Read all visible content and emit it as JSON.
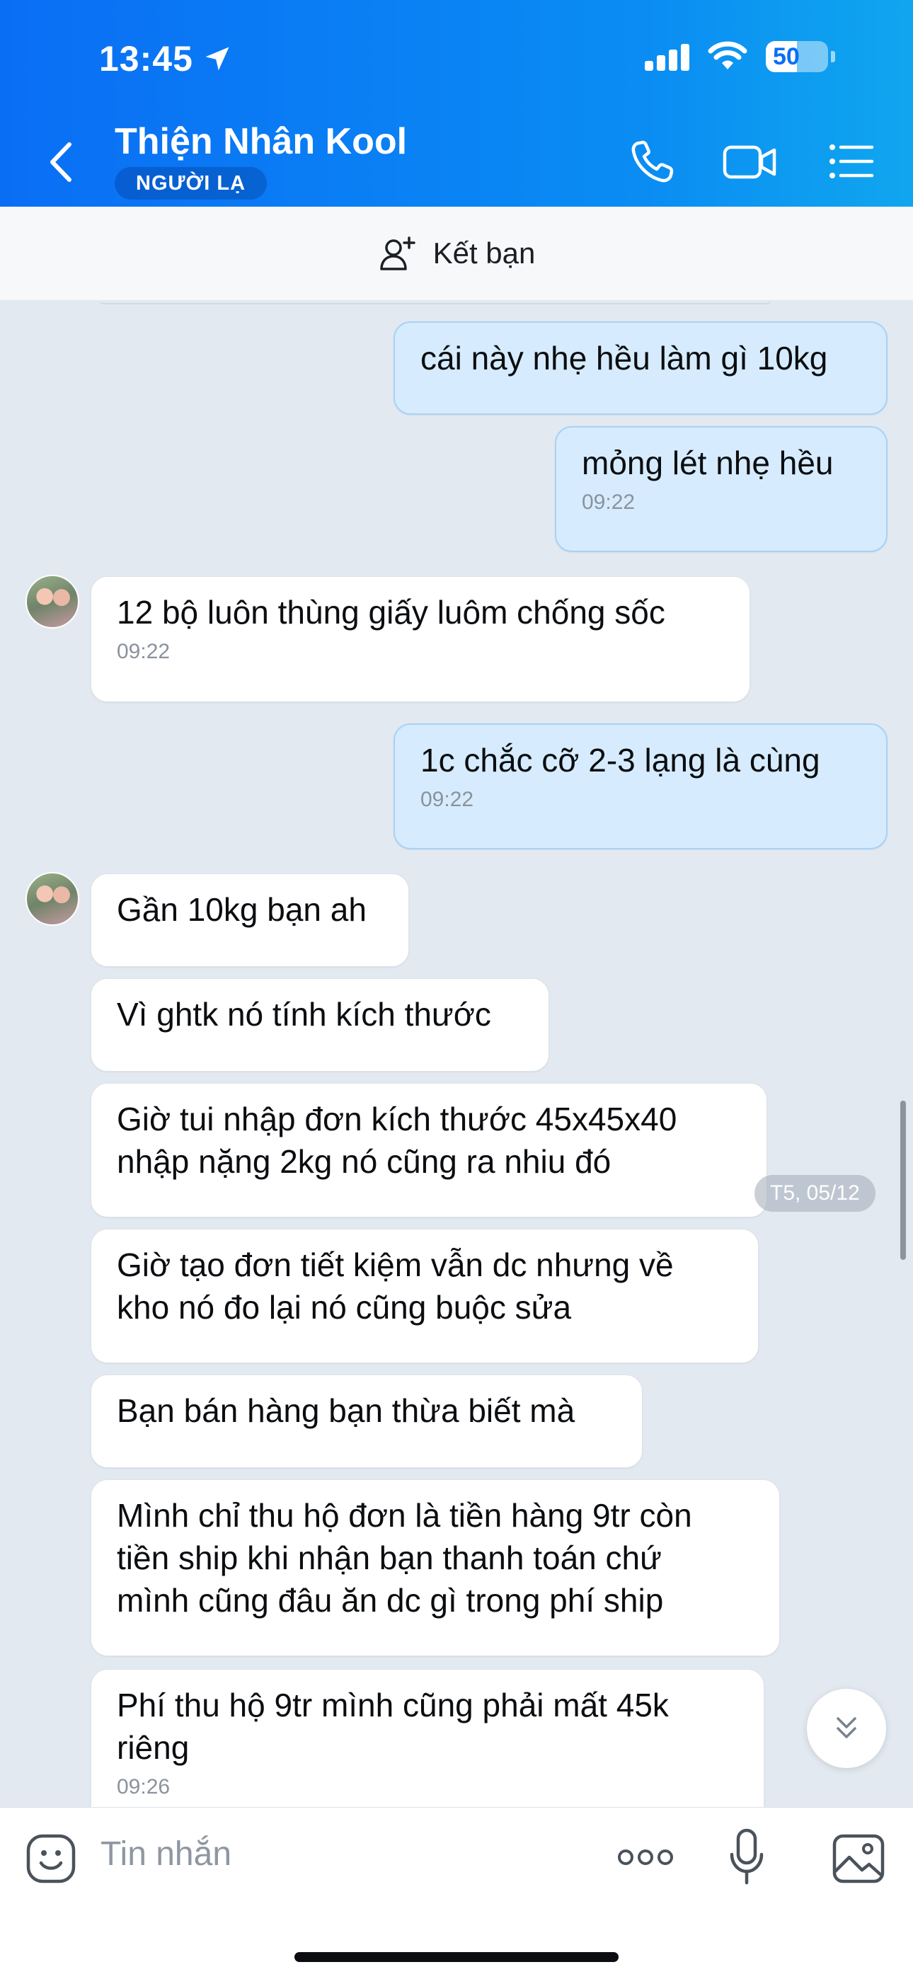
{
  "status_bar": {
    "time": "13:45",
    "battery": "50"
  },
  "header": {
    "contact_name": "Thiện Nhân Kool",
    "badge": "NGƯỜI LẠ"
  },
  "add_friend": {
    "label": "Kết bạn"
  },
  "messages": [
    {
      "side": "out",
      "text": "cái này nhẹ hều làm gì 10kg",
      "time": ""
    },
    {
      "side": "out",
      "text": "mỏng lét nhẹ hều",
      "time": "09:22"
    },
    {
      "side": "in",
      "text": "12 bộ luôn thùng giấy luôm chống sốc",
      "time": "09:22"
    },
    {
      "side": "out",
      "text": "1c chắc cỡ 2-3 lạng là cùng",
      "time": "09:22"
    },
    {
      "side": "in",
      "text": "Gần 10kg bạn ah",
      "time": ""
    },
    {
      "side": "in",
      "text": "Vì ghtk nó tính kích thước",
      "time": ""
    },
    {
      "side": "in",
      "lines": [
        "Giờ tui nhập đơn kích thước 45x45x40",
        "nhập nặng 2kg nó cũng ra nhiu đó"
      ],
      "time": ""
    },
    {
      "side": "in",
      "lines": [
        "Giờ tạo đơn tiết kiệm vẫn dc nhưng về",
        "kho nó đo lại nó cũng buộc sửa"
      ],
      "time": ""
    },
    {
      "side": "in",
      "text": "Bạn bán hàng bạn thừa biết mà",
      "time": ""
    },
    {
      "side": "in",
      "lines": [
        "Mình chỉ thu hộ đơn là tiền hàng 9tr còn",
        "tiền ship khi nhận bạn thanh toán chứ",
        "mình cũng đâu ăn dc gì trong phí ship"
      ],
      "time": ""
    },
    {
      "side": "in",
      "lines": [
        "Phí thu hộ 9tr mình cũng phải mất 45k",
        "riêng"
      ],
      "time": "09:26"
    }
  ],
  "date_divider": "T5, 05/12",
  "input": {
    "placeholder": "Tin nhắn"
  },
  "icons": {
    "location": "location-arrow-icon",
    "back": "chevron-left-icon",
    "call": "phone-icon",
    "video": "video-camera-icon",
    "menu": "list-menu-icon",
    "add_friend": "add-user-icon",
    "scroll_down": "double-chevron-down-icon",
    "sticker": "sticker-face-icon",
    "more": "more-dots-icon",
    "mic": "microphone-icon",
    "image": "image-icon"
  },
  "colors": {
    "header_start": "#0a6ef5",
    "header_end": "#10a6ef",
    "chat_background": "#e2e9f1",
    "outgoing_bubble": "#d6ecfe",
    "incoming_bubble": "#ffffff"
  }
}
